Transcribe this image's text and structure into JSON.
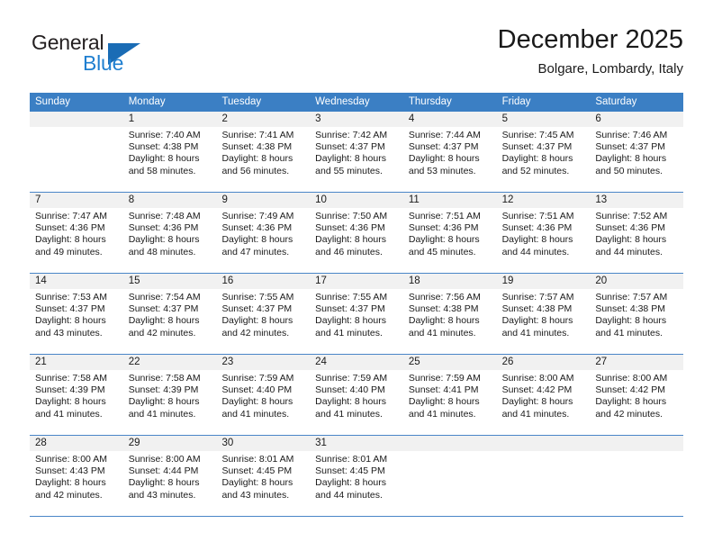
{
  "brand": {
    "name_part1": "General",
    "name_part2": "Blue",
    "mark_icon": "triangle-logo-icon"
  },
  "header": {
    "title": "December 2025",
    "subtitle": "Bolgare, Lombardy, Italy"
  },
  "theme": {
    "header_blue": "#3b7fc4",
    "brand_blue": "#1f7fd0",
    "mark_blue": "#1a6cb5",
    "row_band_gray": "#f1f1f1",
    "cell_white": "#ffffff",
    "grid_line": "#4a86c8",
    "text_dark": "#1a1a1a"
  },
  "weekdays": [
    "Sunday",
    "Monday",
    "Tuesday",
    "Wednesday",
    "Thursday",
    "Friday",
    "Saturday"
  ],
  "weeks": [
    {
      "days": [
        {
          "num": "",
          "lines": []
        },
        {
          "num": "1",
          "lines": [
            "Sunrise: 7:40 AM",
            "Sunset: 4:38 PM",
            "Daylight: 8 hours",
            "and 58 minutes."
          ]
        },
        {
          "num": "2",
          "lines": [
            "Sunrise: 7:41 AM",
            "Sunset: 4:38 PM",
            "Daylight: 8 hours",
            "and 56 minutes."
          ]
        },
        {
          "num": "3",
          "lines": [
            "Sunrise: 7:42 AM",
            "Sunset: 4:37 PM",
            "Daylight: 8 hours",
            "and 55 minutes."
          ]
        },
        {
          "num": "4",
          "lines": [
            "Sunrise: 7:44 AM",
            "Sunset: 4:37 PM",
            "Daylight: 8 hours",
            "and 53 minutes."
          ]
        },
        {
          "num": "5",
          "lines": [
            "Sunrise: 7:45 AM",
            "Sunset: 4:37 PM",
            "Daylight: 8 hours",
            "and 52 minutes."
          ]
        },
        {
          "num": "6",
          "lines": [
            "Sunrise: 7:46 AM",
            "Sunset: 4:37 PM",
            "Daylight: 8 hours",
            "and 50 minutes."
          ]
        }
      ]
    },
    {
      "days": [
        {
          "num": "7",
          "lines": [
            "Sunrise: 7:47 AM",
            "Sunset: 4:36 PM",
            "Daylight: 8 hours",
            "and 49 minutes."
          ]
        },
        {
          "num": "8",
          "lines": [
            "Sunrise: 7:48 AM",
            "Sunset: 4:36 PM",
            "Daylight: 8 hours",
            "and 48 minutes."
          ]
        },
        {
          "num": "9",
          "lines": [
            "Sunrise: 7:49 AM",
            "Sunset: 4:36 PM",
            "Daylight: 8 hours",
            "and 47 minutes."
          ]
        },
        {
          "num": "10",
          "lines": [
            "Sunrise: 7:50 AM",
            "Sunset: 4:36 PM",
            "Daylight: 8 hours",
            "and 46 minutes."
          ]
        },
        {
          "num": "11",
          "lines": [
            "Sunrise: 7:51 AM",
            "Sunset: 4:36 PM",
            "Daylight: 8 hours",
            "and 45 minutes."
          ]
        },
        {
          "num": "12",
          "lines": [
            "Sunrise: 7:51 AM",
            "Sunset: 4:36 PM",
            "Daylight: 8 hours",
            "and 44 minutes."
          ]
        },
        {
          "num": "13",
          "lines": [
            "Sunrise: 7:52 AM",
            "Sunset: 4:36 PM",
            "Daylight: 8 hours",
            "and 44 minutes."
          ]
        }
      ]
    },
    {
      "days": [
        {
          "num": "14",
          "lines": [
            "Sunrise: 7:53 AM",
            "Sunset: 4:37 PM",
            "Daylight: 8 hours",
            "and 43 minutes."
          ]
        },
        {
          "num": "15",
          "lines": [
            "Sunrise: 7:54 AM",
            "Sunset: 4:37 PM",
            "Daylight: 8 hours",
            "and 42 minutes."
          ]
        },
        {
          "num": "16",
          "lines": [
            "Sunrise: 7:55 AM",
            "Sunset: 4:37 PM",
            "Daylight: 8 hours",
            "and 42 minutes."
          ]
        },
        {
          "num": "17",
          "lines": [
            "Sunrise: 7:55 AM",
            "Sunset: 4:37 PM",
            "Daylight: 8 hours",
            "and 41 minutes."
          ]
        },
        {
          "num": "18",
          "lines": [
            "Sunrise: 7:56 AM",
            "Sunset: 4:38 PM",
            "Daylight: 8 hours",
            "and 41 minutes."
          ]
        },
        {
          "num": "19",
          "lines": [
            "Sunrise: 7:57 AM",
            "Sunset: 4:38 PM",
            "Daylight: 8 hours",
            "and 41 minutes."
          ]
        },
        {
          "num": "20",
          "lines": [
            "Sunrise: 7:57 AM",
            "Sunset: 4:38 PM",
            "Daylight: 8 hours",
            "and 41 minutes."
          ]
        }
      ]
    },
    {
      "days": [
        {
          "num": "21",
          "lines": [
            "Sunrise: 7:58 AM",
            "Sunset: 4:39 PM",
            "Daylight: 8 hours",
            "and 41 minutes."
          ]
        },
        {
          "num": "22",
          "lines": [
            "Sunrise: 7:58 AM",
            "Sunset: 4:39 PM",
            "Daylight: 8 hours",
            "and 41 minutes."
          ]
        },
        {
          "num": "23",
          "lines": [
            "Sunrise: 7:59 AM",
            "Sunset: 4:40 PM",
            "Daylight: 8 hours",
            "and 41 minutes."
          ]
        },
        {
          "num": "24",
          "lines": [
            "Sunrise: 7:59 AM",
            "Sunset: 4:40 PM",
            "Daylight: 8 hours",
            "and 41 minutes."
          ]
        },
        {
          "num": "25",
          "lines": [
            "Sunrise: 7:59 AM",
            "Sunset: 4:41 PM",
            "Daylight: 8 hours",
            "and 41 minutes."
          ]
        },
        {
          "num": "26",
          "lines": [
            "Sunrise: 8:00 AM",
            "Sunset: 4:42 PM",
            "Daylight: 8 hours",
            "and 41 minutes."
          ]
        },
        {
          "num": "27",
          "lines": [
            "Sunrise: 8:00 AM",
            "Sunset: 4:42 PM",
            "Daylight: 8 hours",
            "and 42 minutes."
          ]
        }
      ]
    },
    {
      "days": [
        {
          "num": "28",
          "lines": [
            "Sunrise: 8:00 AM",
            "Sunset: 4:43 PM",
            "Daylight: 8 hours",
            "and 42 minutes."
          ]
        },
        {
          "num": "29",
          "lines": [
            "Sunrise: 8:00 AM",
            "Sunset: 4:44 PM",
            "Daylight: 8 hours",
            "and 43 minutes."
          ]
        },
        {
          "num": "30",
          "lines": [
            "Sunrise: 8:01 AM",
            "Sunset: 4:45 PM",
            "Daylight: 8 hours",
            "and 43 minutes."
          ]
        },
        {
          "num": "31",
          "lines": [
            "Sunrise: 8:01 AM",
            "Sunset: 4:45 PM",
            "Daylight: 8 hours",
            "and 44 minutes."
          ]
        },
        {
          "num": "",
          "lines": []
        },
        {
          "num": "",
          "lines": []
        },
        {
          "num": "",
          "lines": []
        }
      ]
    }
  ]
}
